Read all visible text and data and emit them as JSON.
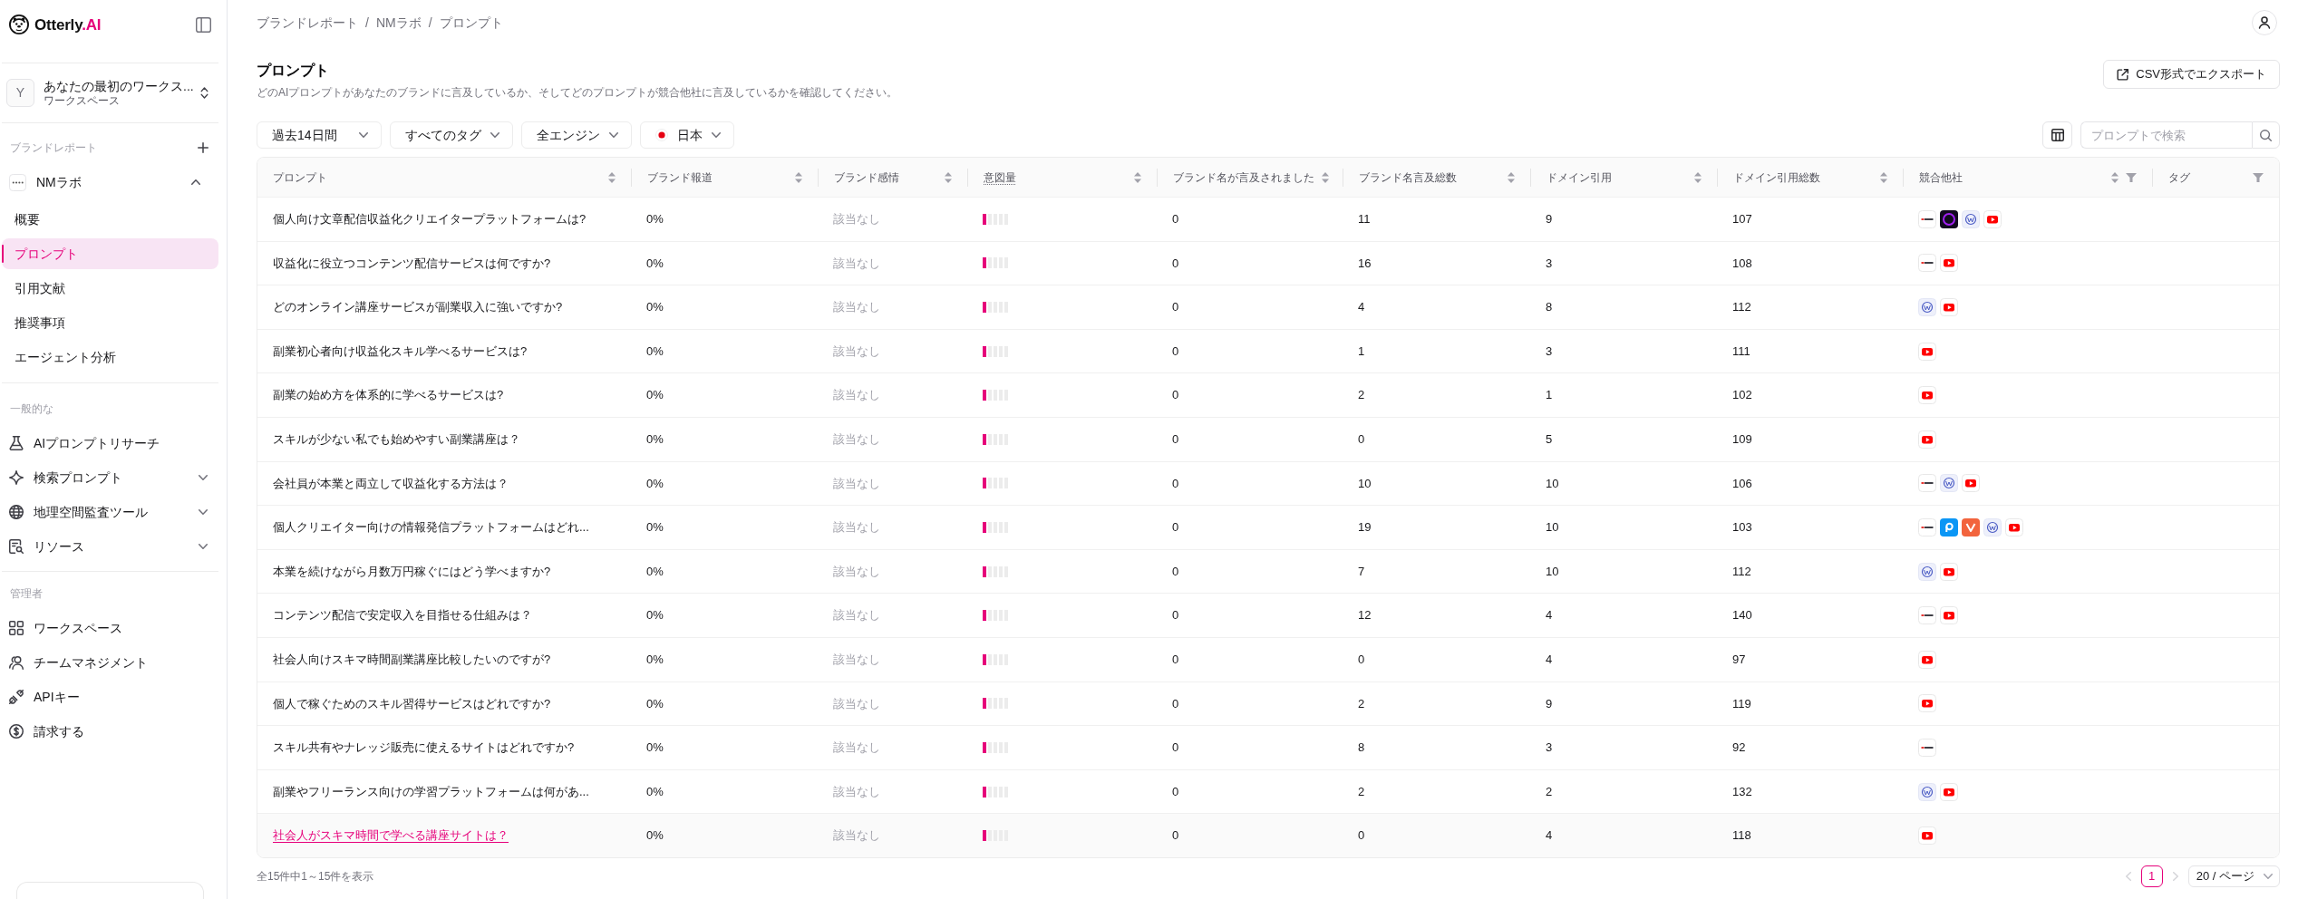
{
  "sidebar": {
    "logo": {
      "name": "Otterly",
      "accent": ".AI"
    },
    "workspace": {
      "initial": "Y",
      "name": "あなたの最初のワークス...",
      "type": "ワークスペース"
    },
    "brand_reports": {
      "label": "ブランドレポート",
      "brands": [
        {
          "name": "NMラボ",
          "expanded": true,
          "children": [
            {
              "label": "概要",
              "selected": false
            },
            {
              "label": "プロンプト",
              "selected": true
            },
            {
              "label": "引用文献",
              "selected": false
            },
            {
              "label": "推奨事項",
              "selected": false
            },
            {
              "label": "エージェント分析",
              "selected": false
            }
          ]
        }
      ]
    },
    "sections": [
      {
        "label": "一般的な",
        "items": [
          {
            "kind": "link",
            "label": "AIプロンプトリサーチ"
          },
          {
            "kind": "group",
            "label": "検索プロンプト",
            "expanded": false
          },
          {
            "kind": "group",
            "label": "地理空間監査ツール",
            "expanded": false
          },
          {
            "kind": "group",
            "label": "リソース",
            "expanded": false
          }
        ]
      },
      {
        "label": "管理者",
        "items": [
          {
            "kind": "link",
            "label": "ワークスペース"
          },
          {
            "kind": "link",
            "label": "チームマネジメント"
          },
          {
            "kind": "link",
            "label": "APIキー"
          },
          {
            "kind": "link",
            "label": "請求する"
          }
        ]
      }
    ]
  },
  "breadcrumb": {
    "separator": "/",
    "items": [
      "ブランドレポート",
      "NMラボ",
      "プロンプト"
    ]
  },
  "header": {
    "title": "プロンプト",
    "description": "どのAIプロンプトがあなたのブランドに言及しているか、そしてどのプロンプトが競合他社に言及しているかを確認してください。",
    "export_button": "CSV形式でエクスポート"
  },
  "filters": [
    {
      "kind": "select",
      "label": "過去14日間"
    },
    {
      "kind": "select",
      "label": "すべてのタグ"
    },
    {
      "kind": "select",
      "label": "全エンジン"
    },
    {
      "kind": "country",
      "label": "日本"
    }
  ],
  "search": {
    "placeholder": "プロンプトで検索"
  },
  "table": {
    "columns": [
      {
        "label": "プロンプト",
        "sortable": true,
        "filterable": false
      },
      {
        "label": "ブランド報道",
        "sortable": true,
        "filterable": false
      },
      {
        "label": "ブランド感情",
        "sortable": true,
        "filterable": false
      },
      {
        "label": "意図量",
        "sortable": true,
        "filterable": false,
        "tooltip": true
      },
      {
        "label": "ブランド名が言及されました",
        "sortable": true,
        "filterable": false
      },
      {
        "label": "ブランド名言及総数",
        "sortable": true,
        "filterable": false
      },
      {
        "label": "ドメイン引用",
        "sortable": true,
        "filterable": false
      },
      {
        "label": "ドメイン引用総数",
        "sortable": true,
        "filterable": false
      },
      {
        "label": "競合他社",
        "sortable": true,
        "filterable": true
      },
      {
        "label": "タグ",
        "sortable": false,
        "filterable": true
      }
    ],
    "rows": [
      {
        "prompt": "個人向け文章配信収益化クリエイタープラットフォームは?",
        "coverage": "0%",
        "sentiment": "該当なし",
        "visibility": {
          "level": 0.2
        },
        "mentioned": "0",
        "mentions_total": "11",
        "domain_citations": "9",
        "domain_citations_total": "107",
        "competitors": [
          {
            "kind": "wordmark"
          },
          {
            "kind": "ring"
          },
          {
            "kind": "circle"
          },
          {
            "kind": "play"
          }
        ],
        "highlighted": false
      },
      {
        "prompt": "収益化に役立つコンテンツ配信サービスは何ですか?",
        "coverage": "0%",
        "sentiment": "該当なし",
        "visibility": {
          "level": 0.2
        },
        "mentioned": "0",
        "mentions_total": "16",
        "domain_citations": "3",
        "domain_citations_total": "108",
        "competitors": [
          {
            "kind": "wordmark"
          },
          {
            "kind": "play"
          }
        ],
        "highlighted": false
      },
      {
        "prompt": "どのオンライン講座サービスが副業収入に強いですか?",
        "coverage": "0%",
        "sentiment": "該当なし",
        "visibility": {
          "level": 0.2
        },
        "mentioned": "0",
        "mentions_total": "4",
        "domain_citations": "8",
        "domain_citations_total": "112",
        "competitors": [
          {
            "kind": "circle"
          },
          {
            "kind": "play"
          }
        ],
        "highlighted": false
      },
      {
        "prompt": "副業初心者向け収益化スキル学べるサービスは?",
        "coverage": "0%",
        "sentiment": "該当なし",
        "visibility": {
          "level": 0.2
        },
        "mentioned": "0",
        "mentions_total": "1",
        "domain_citations": "3",
        "domain_citations_total": "111",
        "competitors": [
          {
            "kind": "play"
          }
        ],
        "highlighted": false
      },
      {
        "prompt": "副業の始め方を体系的に学べるサービスは?",
        "coverage": "0%",
        "sentiment": "該当なし",
        "visibility": {
          "level": 0.2
        },
        "mentioned": "0",
        "mentions_total": "2",
        "domain_citations": "1",
        "domain_citations_total": "102",
        "competitors": [
          {
            "kind": "play"
          }
        ],
        "highlighted": false
      },
      {
        "prompt": "スキルが少ない私でも始めやすい副業講座は？",
        "coverage": "0%",
        "sentiment": "該当なし",
        "visibility": {
          "level": 0.2
        },
        "mentioned": "0",
        "mentions_total": "0",
        "domain_citations": "5",
        "domain_citations_total": "109",
        "competitors": [
          {
            "kind": "play"
          }
        ],
        "highlighted": false
      },
      {
        "prompt": "会社員が本業と両立して収益化する方法は？",
        "coverage": "0%",
        "sentiment": "該当なし",
        "visibility": {
          "level": 0.2
        },
        "mentioned": "0",
        "mentions_total": "10",
        "domain_citations": "10",
        "domain_citations_total": "106",
        "competitors": [
          {
            "kind": "wordmark"
          },
          {
            "kind": "circle"
          },
          {
            "kind": "play"
          }
        ],
        "highlighted": false
      },
      {
        "prompt": "個人クリエイター向けの情報発信プラットフォームはどれ...",
        "coverage": "0%",
        "sentiment": "該当なし",
        "visibility": {
          "level": 0.2
        },
        "mentioned": "0",
        "mentions_total": "19",
        "domain_citations": "10",
        "domain_citations_total": "103",
        "competitors": [
          {
            "kind": "wordmark"
          },
          {
            "kind": "bubble"
          },
          {
            "kind": "vee"
          },
          {
            "kind": "circle"
          },
          {
            "kind": "play"
          }
        ],
        "highlighted": false
      },
      {
        "prompt": "本業を続けながら月数万円稼ぐにはどう学べますか?",
        "coverage": "0%",
        "sentiment": "該当なし",
        "visibility": {
          "level": 0.2
        },
        "mentioned": "0",
        "mentions_total": "7",
        "domain_citations": "10",
        "domain_citations_total": "112",
        "competitors": [
          {
            "kind": "circle"
          },
          {
            "kind": "play"
          }
        ],
        "highlighted": false
      },
      {
        "prompt": "コンテンツ配信で安定収入を目指せる仕組みは？",
        "coverage": "0%",
        "sentiment": "該当なし",
        "visibility": {
          "level": 0.2
        },
        "mentioned": "0",
        "mentions_total": "12",
        "domain_citations": "4",
        "domain_citations_total": "140",
        "competitors": [
          {
            "kind": "wordmark"
          },
          {
            "kind": "play"
          }
        ],
        "highlighted": false
      },
      {
        "prompt": "社会人向けスキマ時間副業講座比較したいのですが?",
        "coverage": "0%",
        "sentiment": "該当なし",
        "visibility": {
          "level": 0.2
        },
        "mentioned": "0",
        "mentions_total": "0",
        "domain_citations": "4",
        "domain_citations_total": "97",
        "competitors": [
          {
            "kind": "play"
          }
        ],
        "highlighted": false
      },
      {
        "prompt": "個人で稼ぐためのスキル習得サービスはどれですか?",
        "coverage": "0%",
        "sentiment": "該当なし",
        "visibility": {
          "level": 0.2
        },
        "mentioned": "0",
        "mentions_total": "2",
        "domain_citations": "9",
        "domain_citations_total": "119",
        "competitors": [
          {
            "kind": "play"
          }
        ],
        "highlighted": false
      },
      {
        "prompt": "スキル共有やナレッジ販売に使えるサイトはどれですか?",
        "coverage": "0%",
        "sentiment": "該当なし",
        "visibility": {
          "level": 0.2
        },
        "mentioned": "0",
        "mentions_total": "8",
        "domain_citations": "3",
        "domain_citations_total": "92",
        "competitors": [
          {
            "kind": "wordmark"
          }
        ],
        "highlighted": false
      },
      {
        "prompt": "副業やフリーランス向けの学習プラットフォームは何があ...",
        "coverage": "0%",
        "sentiment": "該当なし",
        "visibility": {
          "level": 0.2
        },
        "mentioned": "0",
        "mentions_total": "2",
        "domain_citations": "2",
        "domain_citations_total": "132",
        "competitors": [
          {
            "kind": "circle"
          },
          {
            "kind": "play"
          }
        ],
        "highlighted": false
      },
      {
        "prompt": "社会人がスキマ時間で学べる講座サイトは？",
        "coverage": "0%",
        "sentiment": "該当なし",
        "visibility": {
          "level": 0.2
        },
        "mentioned": "0",
        "mentions_total": "0",
        "domain_citations": "4",
        "domain_citations_total": "118",
        "competitors": [
          {
            "kind": "play"
          }
        ],
        "highlighted": true
      }
    ]
  },
  "footer": {
    "summary": "全15件中1～15件を表示",
    "pagination": {
      "previous": {
        "disabled": true
      },
      "pages": [
        {
          "label": "1",
          "selected": true
        }
      ],
      "next": {
        "disabled": true
      },
      "page_size": "20 / ページ"
    }
  }
}
